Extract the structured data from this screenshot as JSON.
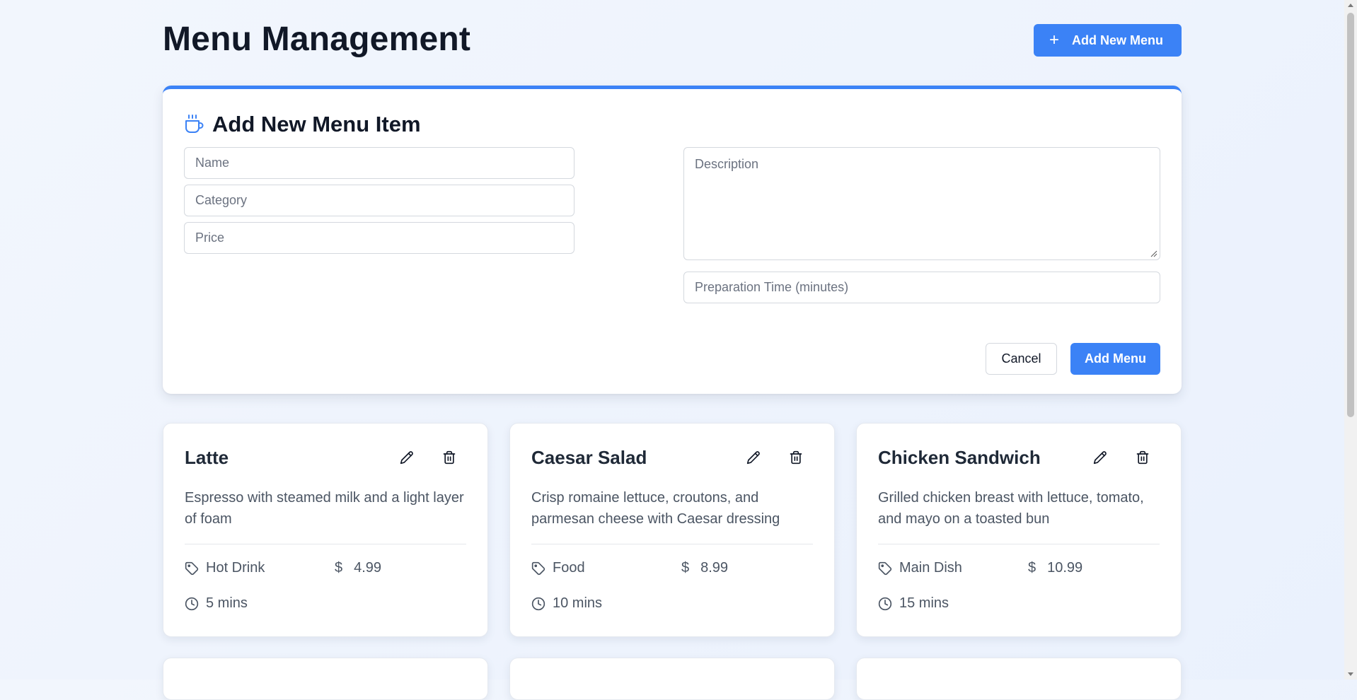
{
  "header": {
    "title": "Menu Management",
    "add_new_label": "Add New Menu"
  },
  "form": {
    "title": "Add New Menu Item",
    "name_placeholder": "Name",
    "category_placeholder": "Category",
    "price_placeholder": "Price",
    "description_placeholder": "Description",
    "prep_time_placeholder": "Preparation Time (minutes)",
    "cancel_label": "Cancel",
    "submit_label": "Add Menu"
  },
  "menu_items": [
    {
      "title": "Latte",
      "description": "Espresso with steamed milk and a light layer of foam",
      "category": "Hot Drink",
      "price_symbol": "$",
      "price": "4.99",
      "prep_time": "5 mins"
    },
    {
      "title": "Caesar Salad",
      "description": "Crisp romaine lettuce, croutons, and parmesan cheese with Caesar dressing",
      "category": "Food",
      "price_symbol": "$",
      "price": "8.99",
      "prep_time": "10 mins"
    },
    {
      "title": "Chicken Sandwich",
      "description": "Grilled chicken breast with lettuce, tomato, and mayo on a toasted bun",
      "category": "Main Dish",
      "price_symbol": "$",
      "price": "10.99",
      "prep_time": "15 mins"
    }
  ],
  "icons": {
    "form_icon": "coffee-cup-icon",
    "edit": "pencil-icon",
    "delete": "trash-icon",
    "category": "tag-icon",
    "time": "clock-icon",
    "add": "plus-icon"
  },
  "colors": {
    "accent": "#3b82f6",
    "background": "#eef3fd"
  }
}
